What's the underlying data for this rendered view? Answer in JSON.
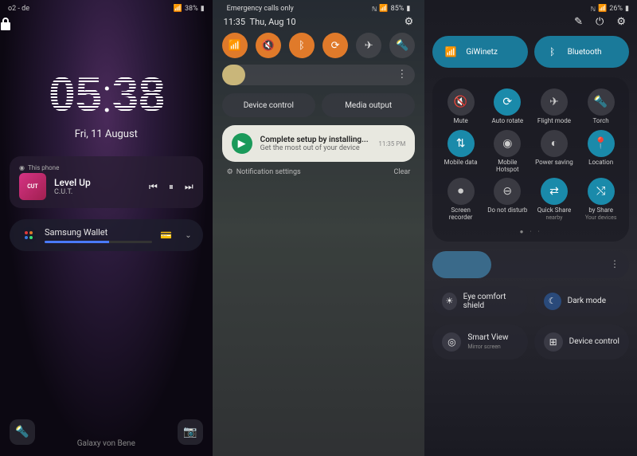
{
  "panel1": {
    "status": {
      "carrier": "o2 - de",
      "battery": "38%"
    },
    "clock": {
      "h1": "0",
      "h2": "5",
      "m1": "3",
      "m2": "8",
      "date": "Fri, 11 August"
    },
    "media": {
      "device": "This phone",
      "title": "Level Up",
      "artist": "C.U.T.",
      "album": "CUT"
    },
    "wallet": {
      "label": "Samsung Wallet"
    },
    "footer": "Galaxy von Bene"
  },
  "panel2": {
    "status": {
      "left": "Emergency calls only",
      "battery": "85%"
    },
    "timerow": {
      "time": "11:35",
      "date": "Thu, Aug 10"
    },
    "qs": [
      {
        "name": "wifi",
        "on": true,
        "glyph": "wifi"
      },
      {
        "name": "sound",
        "on": true,
        "glyph": "mute"
      },
      {
        "name": "bluetooth",
        "on": true,
        "glyph": "bt"
      },
      {
        "name": "rotate",
        "on": true,
        "glyph": "rotate"
      },
      {
        "name": "airplane",
        "on": false,
        "glyph": "plane"
      },
      {
        "name": "torch",
        "on": false,
        "glyph": "torch"
      }
    ],
    "chips": {
      "left": "Device control",
      "right": "Media output"
    },
    "notif": {
      "title": "Complete setup by installing...",
      "sub": "Get the most out of your device",
      "time": "11:35 PM"
    },
    "foot": {
      "left": "Notification settings",
      "right": "Clear"
    }
  },
  "panel3": {
    "status": {
      "battery": "26%"
    },
    "pills": {
      "wifi": "GiWinetz",
      "bt": "Bluetooth"
    },
    "tiles": [
      {
        "label": "Mute",
        "on": false,
        "glyph": "mute"
      },
      {
        "label": "Auto rotate",
        "on": true,
        "glyph": "rotate"
      },
      {
        "label": "Flight mode",
        "on": false,
        "glyph": "plane"
      },
      {
        "label": "Torch",
        "on": false,
        "glyph": "torch"
      },
      {
        "label": "Mobile data",
        "on": true,
        "glyph": "data"
      },
      {
        "label": "Mobile Hotspot",
        "on": false,
        "glyph": "hotspot"
      },
      {
        "label": "Power saving",
        "on": false,
        "glyph": "power"
      },
      {
        "label": "Location",
        "on": true,
        "glyph": "location"
      },
      {
        "label": "Screen recorder",
        "on": false,
        "glyph": "record"
      },
      {
        "label": "Do not disturb",
        "on": false,
        "glyph": "dnd"
      },
      {
        "label": "Quick Share",
        "sub": "nearby",
        "on": true,
        "glyph": "share"
      },
      {
        "label": "by Share",
        "sub": "Your devices",
        "on": true,
        "glyph": "shuffle"
      }
    ],
    "modes": {
      "eye": "Eye comfort shield",
      "dark": "Dark mode"
    },
    "bottom": {
      "smartview": {
        "title": "Smart View",
        "sub": "Mirror screen"
      },
      "device": "Device control"
    }
  }
}
